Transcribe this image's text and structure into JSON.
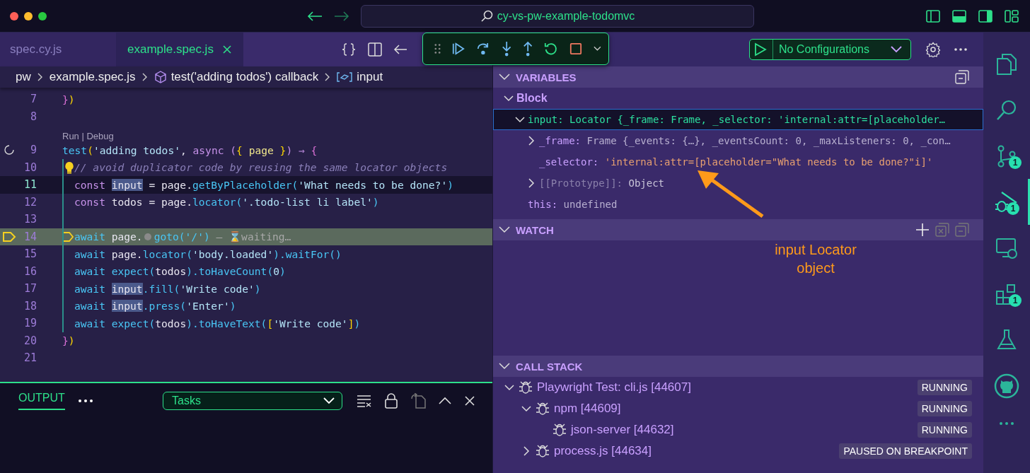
{
  "titlebar": {
    "search_text": "cy-vs-pw-example-todomvc"
  },
  "editor": {
    "tabs": [
      {
        "label": "spec.cy.js",
        "selected": false
      },
      {
        "label": "example.spec.js",
        "selected": true
      }
    ],
    "breadcrumb": [
      {
        "label": "pw",
        "kind": "folder"
      },
      {
        "label": "example.spec.js",
        "kind": "file"
      },
      {
        "label": "test('adding todos') callback",
        "kind": "method"
      },
      {
        "label": "input",
        "kind": "variable"
      }
    ],
    "lines": [
      {
        "number": "7",
        "indented": false,
        "current": false,
        "cursor": false,
        "tokens": [
          {
            "text": "}",
            "kind": "brace"
          },
          {
            "text": ")",
            "kind": "paren"
          }
        ]
      },
      {
        "number": "8",
        "indented": false,
        "current": false,
        "cursor": false
      },
      {
        "number": "9",
        "indented": false,
        "current": false,
        "cursor": false,
        "gutter": {
          "kind": "spinner"
        },
        "codelens": "Run | Debug",
        "tokens": [
          {
            "text": "test",
            "kind": "fn"
          },
          {
            "text": "(",
            "kind": "paren"
          },
          {
            "text": "'adding todos'",
            "kind": "str"
          },
          {
            "text": ", ",
            "kind": "punc"
          },
          {
            "text": "async (",
            "kind": "kw"
          },
          {
            "text": "{ ",
            "kind": "paren"
          },
          {
            "text": "page",
            "kind": "param"
          },
          {
            "text": " }",
            "kind": "paren"
          },
          {
            "text": ") ⇒ ",
            "kind": "kw"
          },
          {
            "text": "{",
            "kind": "brace"
          }
        ]
      },
      {
        "number": "10",
        "indented": true,
        "current": false,
        "cursor": false,
        "lightbulb": true,
        "tokens": [
          {
            "text": "// avoid duplicator code by reusing the same locator objects",
            "kind": "comment"
          }
        ]
      },
      {
        "number": "11",
        "indented": true,
        "current": false,
        "cursor": true,
        "tokens": [
          {
            "text": "const ",
            "kind": "kw"
          },
          {
            "text": "input",
            "kind": "hl"
          },
          {
            "text": " = page.",
            "kind": "punc"
          },
          {
            "text": "getByPlaceholder(",
            "kind": "fn"
          },
          {
            "text": "'What needs to be done?'",
            "kind": "str"
          },
          {
            "text": ")",
            "kind": "fn"
          }
        ]
      },
      {
        "number": "12",
        "indented": true,
        "current": false,
        "cursor": false,
        "tokens": [
          {
            "text": "const",
            "kind": "kw"
          },
          {
            "text": " todos = page.",
            "kind": "punc"
          },
          {
            "text": "locator(",
            "kind": "fn"
          },
          {
            "text": "'.todo-list li label'",
            "kind": "str"
          },
          {
            "text": ")",
            "kind": "fn"
          }
        ]
      },
      {
        "number": "13",
        "indented": true,
        "current": false,
        "cursor": false
      },
      {
        "number": "14",
        "indented": true,
        "current": true,
        "cursor": false,
        "gutter": {
          "kind": "breakpoint"
        },
        "tokens": [
          {
            "text": "await",
            "kind": "fn"
          },
          {
            "text": " page.",
            "kind": "punc"
          },
          {
            "text": "goto('/')",
            "kind": "fn",
            "inline_breakpoint": true
          },
          {
            "text": " — ⌛waiting…",
            "kind": "hint"
          }
        ]
      },
      {
        "number": "15",
        "indented": true,
        "current": false,
        "cursor": false,
        "tokens": [
          {
            "text": "await",
            "kind": "fn"
          },
          {
            "text": " page.",
            "kind": "punc"
          },
          {
            "text": "locator(",
            "kind": "fn"
          },
          {
            "text": "'body.loaded'",
            "kind": "str"
          },
          {
            "text": ").waitFor()",
            "kind": "fn"
          }
        ]
      },
      {
        "number": "16",
        "indented": true,
        "current": false,
        "cursor": false,
        "tokens": [
          {
            "text": "await expect(",
            "kind": "fn"
          },
          {
            "text": "todos",
            "kind": "punc"
          },
          {
            "text": ").toHaveCount(",
            "kind": "fn"
          },
          {
            "text": "0",
            "kind": "str"
          },
          {
            "text": ")",
            "kind": "fn"
          }
        ]
      },
      {
        "number": "17",
        "indented": true,
        "current": false,
        "cursor": false,
        "tokens": [
          {
            "text": "await ",
            "kind": "fn"
          },
          {
            "text": "input",
            "kind": "hl"
          },
          {
            "text": ".fill(",
            "kind": "fn"
          },
          {
            "text": "'Write code'",
            "kind": "str"
          },
          {
            "text": ")",
            "kind": "fn"
          }
        ]
      },
      {
        "number": "18",
        "indented": true,
        "current": false,
        "cursor": false,
        "tokens": [
          {
            "text": "await ",
            "kind": "fn"
          },
          {
            "text": "input",
            "kind": "hl"
          },
          {
            "text": ".press(",
            "kind": "fn"
          },
          {
            "text": "'Enter'",
            "kind": "str"
          },
          {
            "text": ")",
            "kind": "fn"
          }
        ]
      },
      {
        "number": "19",
        "indented": true,
        "current": false,
        "cursor": false,
        "tokens": [
          {
            "text": "await expect(",
            "kind": "fn"
          },
          {
            "text": "todos",
            "kind": "punc"
          },
          {
            "text": ").toHaveText(",
            "kind": "fn"
          },
          {
            "text": "[",
            "kind": "paren"
          },
          {
            "text": "'Write code'",
            "kind": "str"
          },
          {
            "text": "]",
            "kind": "paren"
          },
          {
            "text": ")",
            "kind": "fn"
          }
        ]
      },
      {
        "number": "20",
        "indented": false,
        "current": false,
        "cursor": false,
        "tokens": [
          {
            "text": "}",
            "kind": "brace"
          },
          {
            "text": ")",
            "kind": "paren"
          }
        ]
      },
      {
        "number": "21",
        "indented": false,
        "current": false,
        "cursor": false
      }
    ]
  },
  "output": {
    "tabs": [
      {
        "label": "OUTPUT",
        "selected": true
      }
    ],
    "filter": "Tasks"
  },
  "run_config": "No Configurations",
  "variables": {
    "title": "VARIABLES",
    "expanded": true,
    "items": [
      {
        "kind": "scope",
        "name": "Block",
        "expanded": true,
        "selected": false,
        "children": [
          {
            "kind": "object",
            "name": "input:",
            "value": "Locator {_frame: Frame, _selector: 'internal:attr=[placeholder…",
            "expanded": true,
            "selected": true,
            "children": [
              {
                "kind": "object",
                "name": "_frame:",
                "value": "Frame {_events: {…}, _eventsCount: 0, _maxListeners: 0, _con…",
                "expanded": false,
                "selected": false
              },
              {
                "kind": "string",
                "name": "_selector:",
                "value": "'internal:attr=[placeholder=\"What needs to be done?\"i]'",
                "selected": false
              },
              {
                "kind": "internal",
                "name": "[[Prototype]]:",
                "value": "Object",
                "expanded": false,
                "selected": false
              }
            ]
          },
          {
            "kind": "plain",
            "name": "this:",
            "value": "undefined",
            "selected": false
          }
        ]
      }
    ]
  },
  "watch": {
    "title": "WATCH",
    "expanded": true
  },
  "call_stack": {
    "title": "CALL STACK",
    "expanded": true,
    "items": [
      {
        "label": "Playwright Test: cli.js [44607]",
        "status": "RUNNING",
        "expanded": true,
        "children": [
          {
            "label": "npm [44609]",
            "status": "RUNNING",
            "expanded": true,
            "children": [
              {
                "label": "json-server [44632]",
                "status": "RUNNING"
              }
            ]
          },
          {
            "label": "process.js [44634]",
            "status": "PAUSED ON BREAKPOINT",
            "expanded": false
          }
        ]
      }
    ]
  },
  "annotation": {
    "text": "input Locator object"
  },
  "activity_bar": [
    {
      "kind": "explorer",
      "selected": false
    },
    {
      "kind": "search",
      "selected": false
    },
    {
      "kind": "scm",
      "selected": false,
      "badge": "1"
    },
    {
      "kind": "debug",
      "selected": true,
      "badge": "1"
    },
    {
      "kind": "remote",
      "selected": false
    },
    {
      "kind": "extensions",
      "selected": false,
      "badge": "1"
    },
    {
      "kind": "testing",
      "selected": false
    },
    {
      "kind": "github",
      "selected": false
    }
  ]
}
